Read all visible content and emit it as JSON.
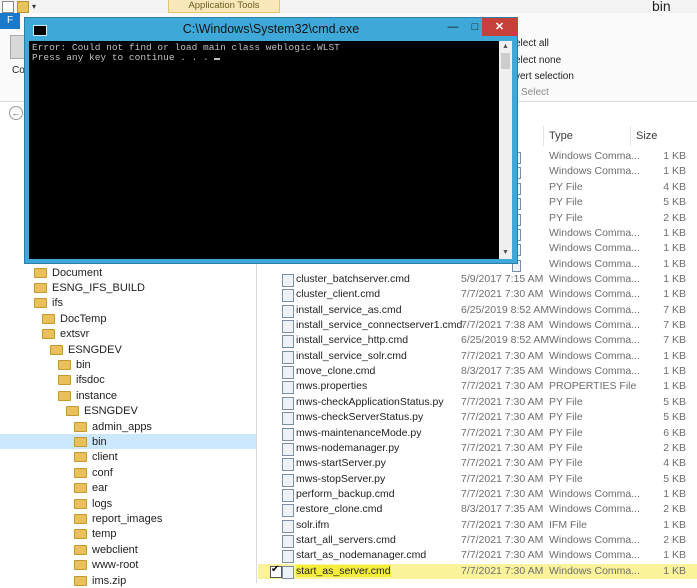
{
  "explorer": {
    "context_tab": "Application Tools",
    "window_title": "bin",
    "file_tab": "F",
    "ribbon_fragment": "Co",
    "selection": {
      "select_all": "elect all",
      "select_none": "elect none",
      "invert": "vert selection",
      "group_label": "Select"
    },
    "columns": {
      "type": "Type",
      "size": "Size"
    }
  },
  "cmd": {
    "title": "C:\\Windows\\System32\\cmd.exe",
    "lines": [
      "Error: Could not find or load main class weblogic.WLST",
      "Press any key to continue . . . "
    ],
    "buttons": {
      "minimize": "—",
      "maximize": "□",
      "close": "✕"
    }
  },
  "partial_rows": [
    {
      "type": "Windows Comma...",
      "size": "1 KB"
    },
    {
      "type": "Windows Comma...",
      "size": "1 KB"
    },
    {
      "type": "PY File",
      "size": "4 KB"
    },
    {
      "type": "PY File",
      "size": "5 KB"
    },
    {
      "type": "PY File",
      "size": "2 KB"
    },
    {
      "type": "Windows Comma...",
      "size": "1 KB"
    },
    {
      "type": "Windows Comma...",
      "size": "1 KB"
    },
    {
      "type": "Windows Comma...",
      "size": "1 KB"
    }
  ],
  "files": [
    {
      "name": "cluster_batchserver.cmd",
      "date": "5/9/2017 7:15 AM",
      "type": "Windows Comma...",
      "size": "1 KB"
    },
    {
      "name": "cluster_client.cmd",
      "date": "7/7/2021 7:30 AM",
      "type": "Windows Comma...",
      "size": "1 KB"
    },
    {
      "name": "install_service_as.cmd",
      "date": "6/25/2019 8:52 AM",
      "type": "Windows Comma...",
      "size": "7 KB"
    },
    {
      "name": "install_service_connectserver1.cmd",
      "date": "7/7/2021 7:38 AM",
      "type": "Windows Comma...",
      "size": "7 KB"
    },
    {
      "name": "install_service_http.cmd",
      "date": "6/25/2019 8:52 AM",
      "type": "Windows Comma...",
      "size": "7 KB"
    },
    {
      "name": "install_service_solr.cmd",
      "date": "7/7/2021 7:30 AM",
      "type": "Windows Comma...",
      "size": "1 KB"
    },
    {
      "name": "move_clone.cmd",
      "date": "8/3/2017 7:35 AM",
      "type": "Windows Comma...",
      "size": "1 KB"
    },
    {
      "name": "mws.properties",
      "date": "7/7/2021 7:30 AM",
      "type": "PROPERTIES File",
      "size": "1 KB"
    },
    {
      "name": "mws-checkApplicationStatus.py",
      "date": "7/7/2021 7:30 AM",
      "type": "PY File",
      "size": "5 KB"
    },
    {
      "name": "mws-checkServerStatus.py",
      "date": "7/7/2021 7:30 AM",
      "type": "PY File",
      "size": "5 KB"
    },
    {
      "name": "mws-maintenanceMode.py",
      "date": "7/7/2021 7:30 AM",
      "type": "PY File",
      "size": "6 KB"
    },
    {
      "name": "mws-nodemanager.py",
      "date": "7/7/2021 7:30 AM",
      "type": "PY File",
      "size": "2 KB"
    },
    {
      "name": "mws-startServer.py",
      "date": "7/7/2021 7:30 AM",
      "type": "PY File",
      "size": "4 KB"
    },
    {
      "name": "mws-stopServer.py",
      "date": "7/7/2021 7:30 AM",
      "type": "PY File",
      "size": "5 KB"
    },
    {
      "name": "perform_backup.cmd",
      "date": "7/7/2021 7:30 AM",
      "type": "Windows Comma...",
      "size": "1 KB"
    },
    {
      "name": "restore_clone.cmd",
      "date": "8/3/2017 7:35 AM",
      "type": "Windows Comma...",
      "size": "2 KB"
    },
    {
      "name": "solr.ifm",
      "date": "7/7/2021 7:30 AM",
      "type": "IFM File",
      "size": "1 KB"
    },
    {
      "name": "start_all_servers.cmd",
      "date": "7/7/2021 7:30 AM",
      "type": "Windows Comma...",
      "size": "2 KB"
    },
    {
      "name": "start_as_nodemanager.cmd",
      "date": "7/7/2021 7:30 AM",
      "type": "Windows Comma...",
      "size": "1 KB"
    },
    {
      "name": "start_as_server.cmd",
      "date": "7/7/2021 7:30 AM",
      "type": "Windows Comma...",
      "size": "1 KB",
      "checked": true,
      "highlighted": true
    }
  ],
  "tree": [
    {
      "label": "Document"
    },
    {
      "label": "ESNG_IFS_BUILD"
    },
    {
      "label": "ifs"
    },
    {
      "label": "DocTemp"
    },
    {
      "label": "extsvr"
    },
    {
      "label": "ESNGDEV"
    },
    {
      "label": "bin"
    },
    {
      "label": "ifsdoc"
    },
    {
      "label": "instance"
    },
    {
      "label": "ESNGDEV"
    },
    {
      "label": "admin_apps"
    },
    {
      "label": "bin",
      "selected": true
    },
    {
      "label": "client"
    },
    {
      "label": "conf"
    },
    {
      "label": "ear"
    },
    {
      "label": "logs"
    },
    {
      "label": "report_images"
    },
    {
      "label": "temp"
    },
    {
      "label": "webclient"
    },
    {
      "label": "www-root"
    },
    {
      "label": "ims.zip"
    }
  ]
}
